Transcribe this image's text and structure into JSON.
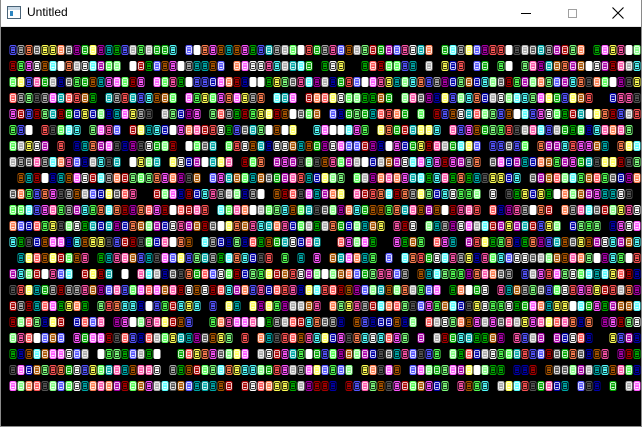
{
  "window": {
    "title": "Untitled",
    "app_icon": "console-window-icon",
    "controls": {
      "minimize": "minimize-icon",
      "maximize": "maximize-icon",
      "close": "close-icon"
    }
  },
  "client": {
    "background": "#000000",
    "grid": {
      "rows": 22,
      "columns": 79,
      "glyph": "☺",
      "glyph_alt": "☻",
      "palette": [
        "#ff55ff",
        "#55ff55",
        "#55ffff",
        "#ffff55",
        "#ff5555",
        "#5555ff",
        "#aa00aa",
        "#00aa00",
        "#00aaaa",
        "#aa5500",
        "#aa0000",
        "#0000aa",
        "#aaaaaa",
        "#555555",
        "#ffffff",
        "#ff7f50",
        "#7fff7f",
        "#ff55aa"
      ]
    }
  }
}
